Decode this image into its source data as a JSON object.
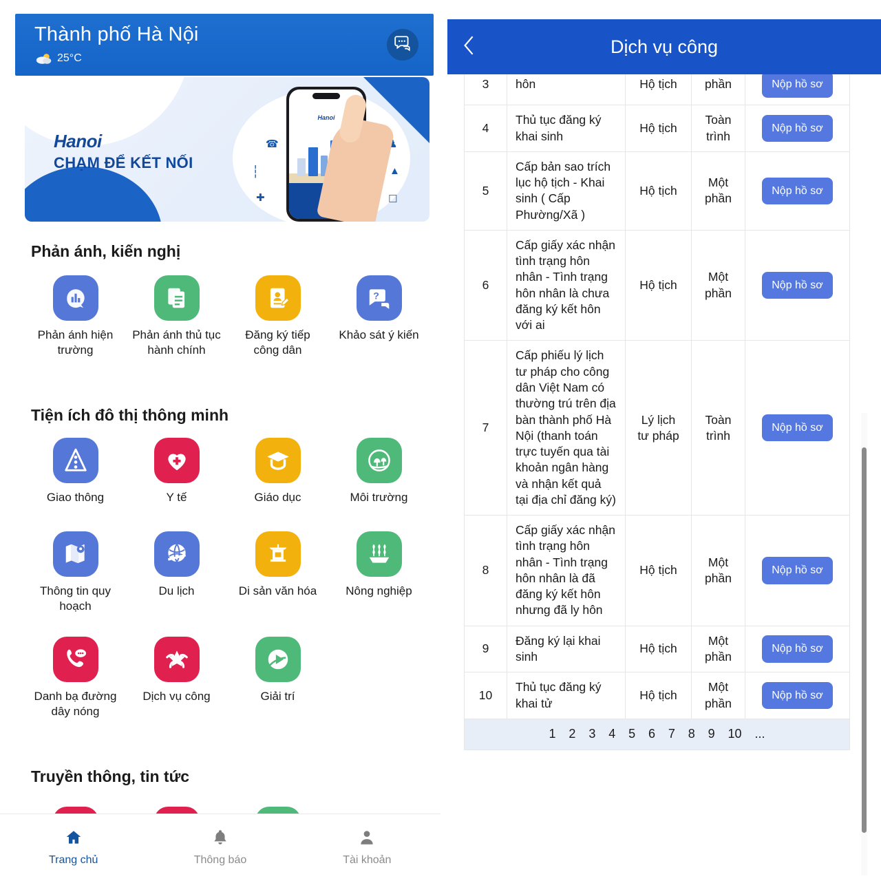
{
  "left": {
    "header": {
      "title": "Thành phố Hà Nội",
      "weather_icon": "sun-cloud-icon",
      "temperature": "25°C",
      "chat_icon": "chat-bubble-icon"
    },
    "banner": {
      "logo": "Hanoi",
      "slogan": "CHẠM ĐỂ KẾT NỐI",
      "phone_app_label": "Hanoi"
    },
    "sections": [
      {
        "title": "Phản ánh, kiến nghị",
        "items": [
          {
            "label": "Phản ánh hiện trường",
            "icon": "megaphone-chat-icon",
            "color": "#5477d8"
          },
          {
            "label": "Phản ánh thủ tục hành chính",
            "icon": "documents-icon",
            "color": "#4eb978"
          },
          {
            "label": "Đăng ký tiếp công dân",
            "icon": "id-card-pen-icon",
            "color": "#f2b10c"
          },
          {
            "label": "Khảo sát ý kiến",
            "icon": "question-chat-icon",
            "color": "#5477d8"
          }
        ]
      },
      {
        "title": "Tiện ích đô thị thông minh",
        "items": [
          {
            "label": "Giao thông",
            "icon": "traffic-light-icon",
            "color": "#5477d8"
          },
          {
            "label": "Y tế",
            "icon": "heart-cross-icon",
            "color": "#e0204f"
          },
          {
            "label": "Giáo dục",
            "icon": "graduation-cap-icon",
            "color": "#f2b10c"
          },
          {
            "label": "Môi trường",
            "icon": "tree-globe-icon",
            "color": "#4eb978"
          },
          {
            "label": "Thông tin quy hoạch",
            "icon": "map-pin-icon",
            "color": "#5477d8"
          },
          {
            "label": "Du lịch",
            "icon": "globe-travel-icon",
            "color": "#5477d8"
          },
          {
            "label": "Di sản văn hóa",
            "icon": "temple-gate-icon",
            "color": "#f2b10c"
          },
          {
            "label": "Nông nghiệp",
            "icon": "wheat-field-icon",
            "color": "#4eb978"
          },
          {
            "label": "Danh bạ đường dây nóng",
            "icon": "phone-chat-icon",
            "color": "#e0204f"
          },
          {
            "label": "Dịch vụ công",
            "icon": "star-hands-icon",
            "color": "#e0204f"
          },
          {
            "label": "Giải trí",
            "icon": "play-circle-icon",
            "color": "#4eb978"
          }
        ]
      },
      {
        "title": "Truyền thông, tin tức",
        "items": [
          {
            "label": "",
            "icon": "news-icon-1",
            "color": "#e0204f"
          },
          {
            "label": "",
            "icon": "news-icon-2",
            "color": "#e0204f"
          },
          {
            "label": "",
            "icon": "news-icon-3",
            "color": "#4eb978"
          }
        ]
      }
    ],
    "bottom_nav": [
      {
        "label": "Trang chủ",
        "icon": "home-icon",
        "active": true
      },
      {
        "label": "Thông báo",
        "icon": "bell-icon",
        "active": false
      },
      {
        "label": "Tài khoản",
        "icon": "user-icon",
        "active": false
      }
    ]
  },
  "right": {
    "header": {
      "back_icon": "chevron-left-icon",
      "title": "Dịch vụ công"
    },
    "table": {
      "rows": [
        {
          "index": "3",
          "name": "hôn",
          "category": "Hộ tịch",
          "level": "phần",
          "action": "Nộp hồ sơ",
          "partial": true
        },
        {
          "index": "4",
          "name": "Thủ tục đăng ký khai sinh",
          "category": "Hộ tịch",
          "level": "Toàn trình",
          "action": "Nộp hồ sơ"
        },
        {
          "index": "5",
          "name": "Cấp bản sao trích lục hộ tịch - Khai sinh ( Cấp Phường/Xã )",
          "category": "Hộ tịch",
          "level": "Một phần",
          "action": "Nộp hồ sơ"
        },
        {
          "index": "6",
          "name": "Cấp giấy xác nhận tình trạng hôn nhân - Tình trạng hôn nhân là chưa đăng ký kết hôn với ai",
          "category": "Hộ tịch",
          "level": "Một phần",
          "action": "Nộp hồ sơ"
        },
        {
          "index": "7",
          "name": "Cấp phiếu lý lịch tư pháp cho công dân Việt Nam có thường trú trên địa bàn thành phố Hà Nội (thanh toán trực tuyến qua tài khoản ngân hàng và nhận kết quả tại địa chỉ đăng ký)",
          "category": "Lý lịch tư pháp",
          "level": "Toàn trình",
          "action": "Nộp hồ sơ"
        },
        {
          "index": "8",
          "name": "Cấp giấy xác nhận tình trạng hôn nhân - Tình trạng hôn nhân là đã đăng ký kết hôn nhưng đã ly hôn",
          "category": "Hộ tịch",
          "level": "Một phần",
          "action": "Nộp hồ sơ"
        },
        {
          "index": "9",
          "name": "Đăng ký lại khai sinh",
          "category": "Hộ tịch",
          "level": "Một phần",
          "action": "Nộp hồ sơ"
        },
        {
          "index": "10",
          "name": "Thủ tục đăng ký khai tử",
          "category": "Hộ tịch",
          "level": "Một phần",
          "action": "Nộp hồ sơ"
        }
      ],
      "pagination": [
        "1",
        "2",
        "3",
        "4",
        "5",
        "6",
        "7",
        "8",
        "9",
        "10",
        "..."
      ]
    }
  },
  "colors": {
    "header_blue": "#1565c9",
    "dv_header_blue": "#1854c8",
    "button_blue": "#5478e0",
    "pager_bg": "#e8eef8"
  }
}
